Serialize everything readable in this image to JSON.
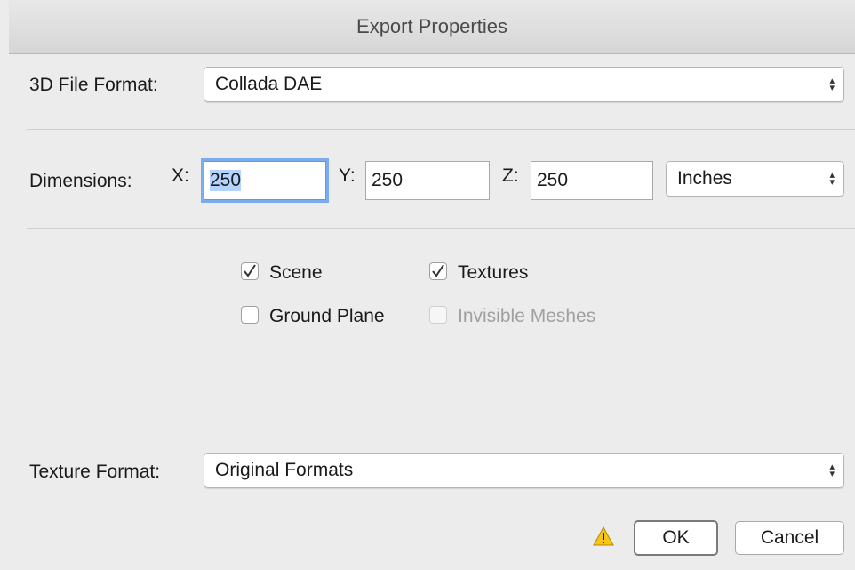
{
  "window": {
    "title": "Export Properties"
  },
  "file_format": {
    "label": "3D File Format:",
    "value": "Collada DAE"
  },
  "dimensions": {
    "label": "Dimensions:",
    "x_label": "X:",
    "x_value": "250",
    "y_label": "Y:",
    "y_value": "250",
    "z_label": "Z:",
    "z_value": "250",
    "units": "Inches"
  },
  "options": {
    "scene": {
      "label": "Scene",
      "checked": true
    },
    "textures": {
      "label": "Textures",
      "checked": true
    },
    "ground_plane": {
      "label": "Ground Plane",
      "checked": false
    },
    "invisible_meshes": {
      "label": "Invisible Meshes",
      "checked": false,
      "disabled": true
    }
  },
  "texture_format": {
    "label": "Texture Format:",
    "value": "Original Formats"
  },
  "buttons": {
    "ok": "OK",
    "cancel": "Cancel"
  },
  "icons": {
    "select_arrows": "updown-chevron-icon",
    "warning": "warning-icon",
    "check": "checkmark-icon"
  },
  "colors": {
    "focus_ring": "#7aacf0",
    "warning_fill": "#f5c518"
  }
}
